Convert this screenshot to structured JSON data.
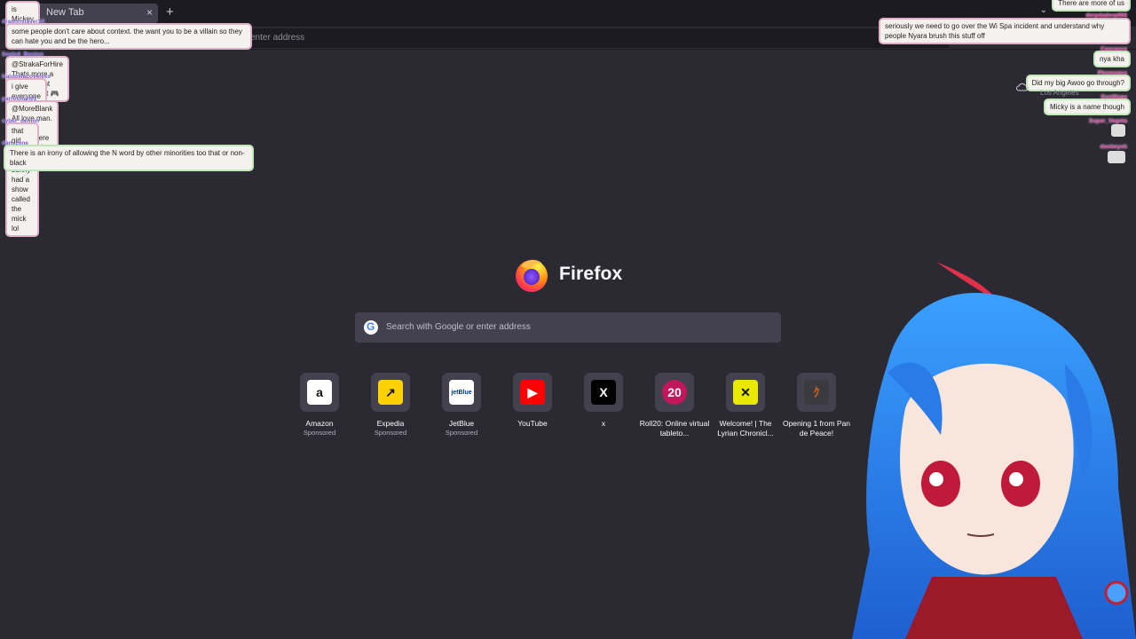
{
  "browser": {
    "tab_title": "New Tab",
    "new_tab": "+",
    "close": "×",
    "address_placeholder": "enter address"
  },
  "newtab": {
    "brand": "Firefox",
    "search_placeholder": "Search with Google or enter address",
    "shortcuts": [
      {
        "name": "Amazon",
        "sub": "Sponsored",
        "icon": "amazon-icon",
        "glyph": "a",
        "bg": "#ffffff",
        "fg": "#111111"
      },
      {
        "name": "Expedia",
        "sub": "Sponsored",
        "icon": "expedia-icon",
        "glyph": "↗",
        "bg": "#ffd100",
        "fg": "#111111"
      },
      {
        "name": "JetBlue",
        "sub": "Sponsored",
        "icon": "jetblue-icon",
        "glyph": "jetBlue",
        "bg": "#ffffff",
        "fg": "#003876"
      },
      {
        "name": "YouTube",
        "sub": "",
        "icon": "youtube-icon",
        "glyph": "▶",
        "bg": "#ff0000",
        "fg": "#ffffff"
      },
      {
        "name": "x",
        "sub": "",
        "icon": "x-icon",
        "glyph": "X",
        "bg": "#000000",
        "fg": "#ffffff"
      },
      {
        "name": "Roll20: Online virtual tableto...",
        "sub": "",
        "icon": "roll20-icon",
        "glyph": "20",
        "bg": "#c2185b",
        "fg": "#ffffff"
      },
      {
        "name": "Welcome! | The Lyrian Chronicl...",
        "sub": "",
        "icon": "lyrian-icon",
        "glyph": "✕",
        "bg": "#e8e800",
        "fg": "#111111"
      },
      {
        "name": "Opening 1 from Pan de Peace!",
        "sub": "",
        "icon": "pandepeace-icon",
        "glyph": "ｸ",
        "bg": "#3a3a40",
        "fg": "#d06020"
      }
    ]
  },
  "chat_left": [
    {
      "user": "",
      "text": "is Mickey Mouse Irish?"
    },
    {
      "user": "dragonslayer14",
      "text": "some people don't care about context. the want you to be a villain so they can hate you and be the hero..."
    },
    {
      "user": "Sealed_Boston",
      "text": "@StrakaForHire Thats more a mix of intent and context 🎮"
    },
    {
      "user": "KalopsiaLoveless",
      "text": "i give everyone the irish scottish and ginger passes"
    },
    {
      "user": "parrotman01",
      "text": "@MoreBlank All love man. Ain't no money here neither. 🤌"
    },
    {
      "user": "cyber_demon",
      "text": "that girl from always sunny had a show called the mick lol"
    },
    {
      "user": "dan_zone",
      "text": "There is an irony of allowing the N word by other minorities too that or non-black"
    }
  ],
  "chat_right": [
    {
      "user": "",
      "text": "There are more of us"
    },
    {
      "user": "derpdaderp666",
      "text": "seriously we need to go over the Wi Spa incident and understand why people Nyara brush this stuff off"
    },
    {
      "user": "Courance",
      "text": "nya kha"
    },
    {
      "user": "Phomegus",
      "text": "Did my big Awoo go through?"
    },
    {
      "user": "GunMage",
      "text": "Micky is a name though"
    },
    {
      "user": "Super_Vegeta",
      "text": ""
    },
    {
      "user": "donkeyok",
      "text": ""
    }
  ],
  "weather": {
    "location": "Los Angeles"
  }
}
